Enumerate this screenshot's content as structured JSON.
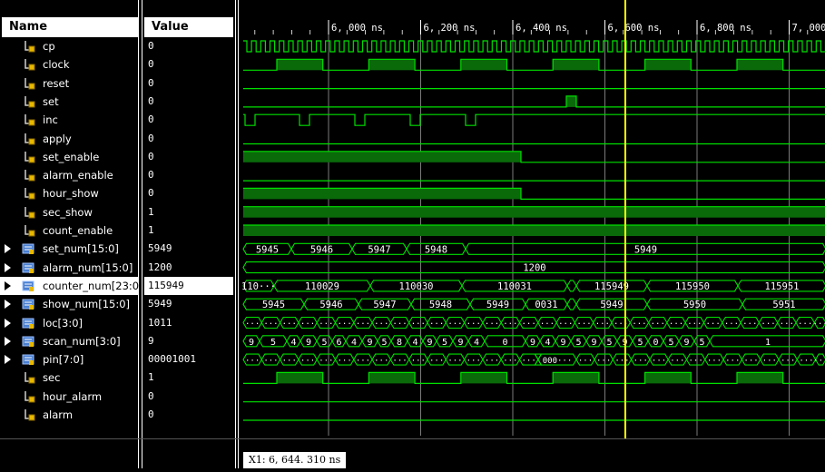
{
  "headers": {
    "name": "Name",
    "value": "Value"
  },
  "timeline": {
    "ticks": [
      "6, 000 ns",
      "6, 200 ns",
      "6, 400 ns",
      "6, 600 ns",
      "6, 800 ns",
      "7, 000 n"
    ],
    "cursor_label": "X1: 6, 644. 310 ns"
  },
  "colors": {
    "wave": "#00e000",
    "fill": "#0a6a0a",
    "cursor": "#ffff00",
    "grid": "#7a7a7a"
  },
  "signals": [
    {
      "name": "cp",
      "value": "0",
      "bus": false
    },
    {
      "name": "clock",
      "value": "0",
      "bus": false
    },
    {
      "name": "reset",
      "value": "0",
      "bus": false
    },
    {
      "name": "set",
      "value": "0",
      "bus": false
    },
    {
      "name": "inc",
      "value": "0",
      "bus": false
    },
    {
      "name": "apply",
      "value": "0",
      "bus": false
    },
    {
      "name": "set_enable",
      "value": "0",
      "bus": false
    },
    {
      "name": "alarm_enable",
      "value": "0",
      "bus": false
    },
    {
      "name": "hour_show",
      "value": "0",
      "bus": false
    },
    {
      "name": "sec_show",
      "value": "1",
      "bus": false
    },
    {
      "name": "count_enable",
      "value": "1",
      "bus": false
    },
    {
      "name": "set_num[15:0]",
      "value": "5949",
      "bus": true
    },
    {
      "name": "alarm_num[15:0]",
      "value": "1200",
      "bus": true
    },
    {
      "name": "counter_num[23:0]",
      "value": "115949",
      "bus": true,
      "selected": true
    },
    {
      "name": "show_num[15:0]",
      "value": "5949",
      "bus": true
    },
    {
      "name": "loc[3:0]",
      "value": "1011",
      "bus": true
    },
    {
      "name": "scan_num[3:0]",
      "value": "9",
      "bus": true
    },
    {
      "name": "pin[7:0]",
      "value": "00001001",
      "bus": true
    },
    {
      "name": "sec",
      "value": "1",
      "bus": false
    },
    {
      "name": "hour_alarm",
      "value": "0",
      "bus": false
    },
    {
      "name": "alarm",
      "value": "0",
      "bus": false
    }
  ],
  "bus_segments": {
    "set_num": [
      "5945",
      "5946",
      "5947",
      "5948",
      "5949"
    ],
    "alarm_num": [
      "1200"
    ],
    "counter_num": [
      "110···",
      "110029",
      "110030",
      "110031",
      "115949",
      "115950",
      "115951"
    ],
    "show_num": [
      "5945",
      "5946",
      "5947",
      "5948",
      "5949",
      "0031",
      "5949",
      "5950",
      "5951"
    ],
    "loc": [
      "···"
    ],
    "scan_num": [
      "9",
      "5",
      "4",
      "9",
      "5",
      "6",
      "4",
      "9",
      "5",
      "8",
      "4",
      "9",
      "5",
      "9",
      "4",
      "0",
      "9",
      "4",
      "9",
      "5",
      "9",
      "5",
      "9",
      "5",
      "0",
      "5",
      "9",
      "5",
      "1"
    ],
    "pin": [
      "···",
      "000···"
    ]
  }
}
